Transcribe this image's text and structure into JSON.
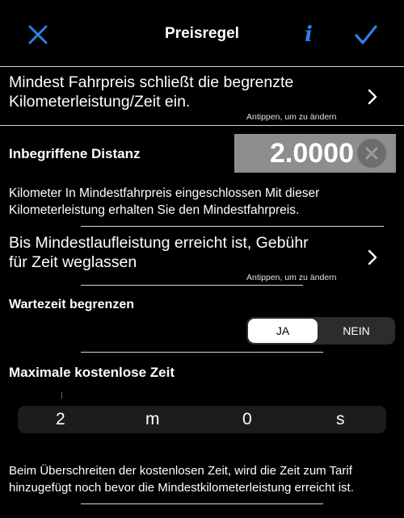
{
  "nav": {
    "title": "Preisregel"
  },
  "row1": {
    "text_line1": "Mindest Fahrpreis schließt die begrenzte",
    "text_line2": "Kilometerleistung/Zeit ein.",
    "hint": "Antippen, um zu ändern"
  },
  "distance": {
    "label": "Inbegriffene Distanz",
    "value": "2.0000",
    "desc_line1": "Kilometer In Mindestfahrpreis eingeschlossen Mit dieser",
    "desc_line2": "Kilometerleistung erhalten Sie den Mindestfahrpreis."
  },
  "row2": {
    "text_line1": "Bis Mindestlaufleistung erreicht ist, Gebühr",
    "text_line2": "für Zeit weglassen",
    "hint": "Antippen, um zu ändern"
  },
  "wait": {
    "label": "Wartezeit begrenzen",
    "yes": "JA",
    "no": "NEIN",
    "selected": "JA"
  },
  "freetime": {
    "label": "Maximale kostenlose Zeit",
    "minutes": "2",
    "minutes_unit": "m",
    "seconds": "0",
    "seconds_unit": "s"
  },
  "footer": {
    "line1": "Beim Überschreiten der kostenlosen Zeit, wird die Zeit zum Tarif",
    "line2": "hinzugefügt noch bevor die Mindestkilometerleistung erreicht ist."
  },
  "colors": {
    "accent": "#2f7fe8",
    "background": "#000000"
  }
}
